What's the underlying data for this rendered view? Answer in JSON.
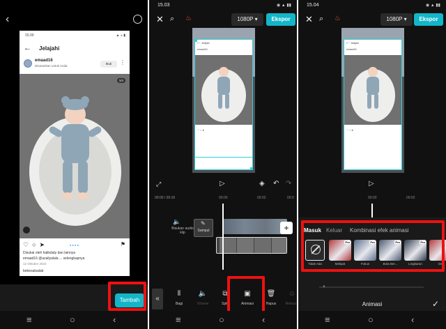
{
  "panel1": {
    "phone": {
      "status_time": "15.00",
      "title": "Jelajahi",
      "username": "emaad16",
      "subtitle": "Disarankan untuk Anda",
      "follow_label": "Ikuti",
      "photo_counter": "1/4",
      "likes": "Disukai oleh halikdaly dan lainnya",
      "caption": "emaad16 @azaliyalala ... selengkapnya",
      "date": "12 Oktober 2023",
      "comment_user": "bebesalsalab"
    },
    "tambah_label": "Tambah"
  },
  "panel2": {
    "status_time": "15.03",
    "resolution": "1080P",
    "export_label": "Ekspor",
    "timecode": "00:00 / 00:16",
    "tick_a": "00:00",
    "tick_b": "00:02",
    "tick_c": "00:0",
    "audio_label": "Bisukan audio klip",
    "sampul_label": "Sampul",
    "toolbar": [
      {
        "icon": "split-icon",
        "glyph": "⫴",
        "label": "Bagi",
        "dim": false
      },
      {
        "icon": "volume-icon",
        "glyph": "🔈",
        "label": "Volume",
        "dim": true
      },
      {
        "icon": "split2-icon",
        "glyph": "⧉",
        "label": "Split",
        "dim": false
      },
      {
        "icon": "animation-icon",
        "glyph": "▣",
        "label": "Animasi",
        "dim": false
      },
      {
        "icon": "delete-icon",
        "glyph": "🗑",
        "label": "Hapus",
        "dim": false
      },
      {
        "icon": "retouch-icon",
        "glyph": "☺",
        "label": "Retouch",
        "dim": true
      }
    ]
  },
  "panel3": {
    "status_time": "15.04",
    "resolution": "1080P",
    "export_label": "Ekspor",
    "tick_a": "00:00",
    "tick_b": "00:02",
    "tabs": {
      "in": "Masuk",
      "out": "Keluar",
      "combo": "Kombinasi efek animasi"
    },
    "none_label": "Tidak Ada",
    "effects": [
      {
        "label": "Melipat",
        "color": "#b23a3a"
      },
      {
        "label": "Fokus",
        "color": "#5a6e8c"
      },
      {
        "label": "Bola Ber...",
        "color": "#4c5a72"
      },
      {
        "label": "Lingkaran",
        "color": "#2f3a4d"
      },
      {
        "label": "De",
        "color": "#b23a3a"
      }
    ],
    "pro_badge": "Pro",
    "title": "Animasi"
  },
  "colors": {
    "accent": "#13b6c8",
    "highlight": "#e11111"
  }
}
